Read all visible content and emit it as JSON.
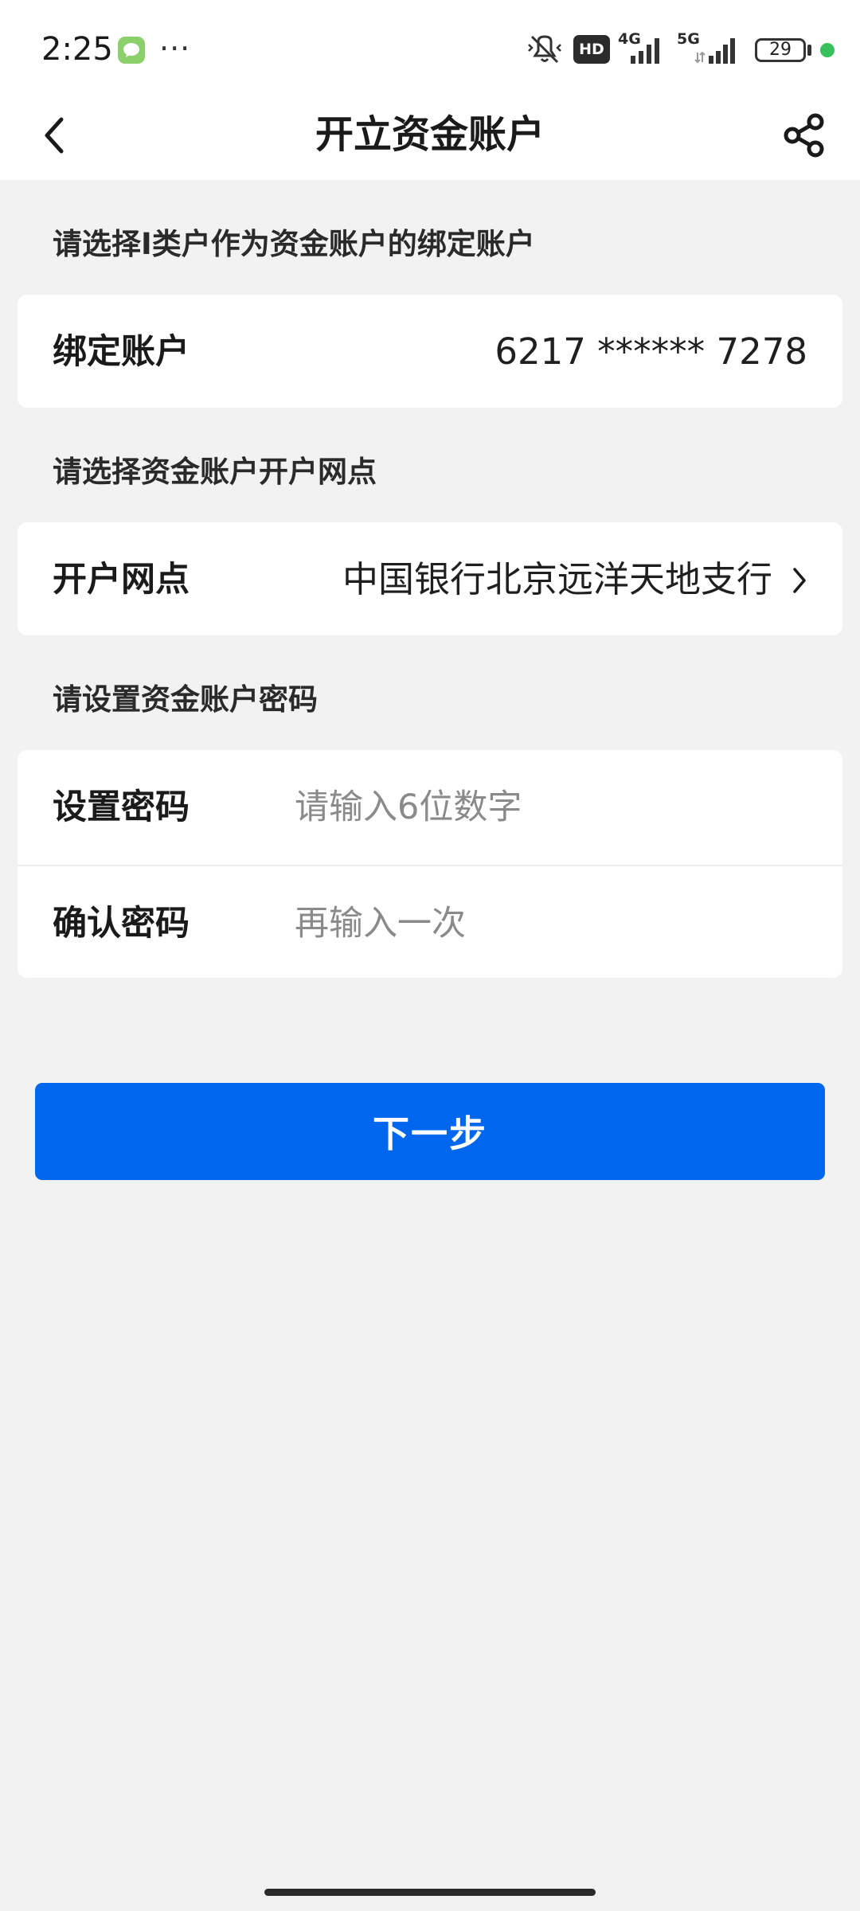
{
  "status_bar": {
    "time": "2:25",
    "dots": "···",
    "hd_label": "HD",
    "net1_label": "4G",
    "net2_label": "5G",
    "battery": "29",
    "dot_color": "#38c05c"
  },
  "header": {
    "title": "开立资金账户",
    "back_icon": "chevron-left-icon",
    "share_icon": "share-icon"
  },
  "sections": {
    "bind_hint": "请选择I类户作为资金账户的绑定账户",
    "branch_hint": "请选择资金账户开户网点",
    "password_hint": "请设置资金账户密码"
  },
  "bind_account": {
    "label": "绑定账户",
    "value": "6217 ****** 7278"
  },
  "branch": {
    "label": "开户网点",
    "value": "中国银行北京远洋天地支行"
  },
  "password": {
    "set_label": "设置密码",
    "set_placeholder": "请输入6位数字",
    "confirm_label": "确认密码",
    "confirm_placeholder": "再输入一次"
  },
  "next_button": {
    "label": "下一步",
    "color": "#0066ee"
  }
}
